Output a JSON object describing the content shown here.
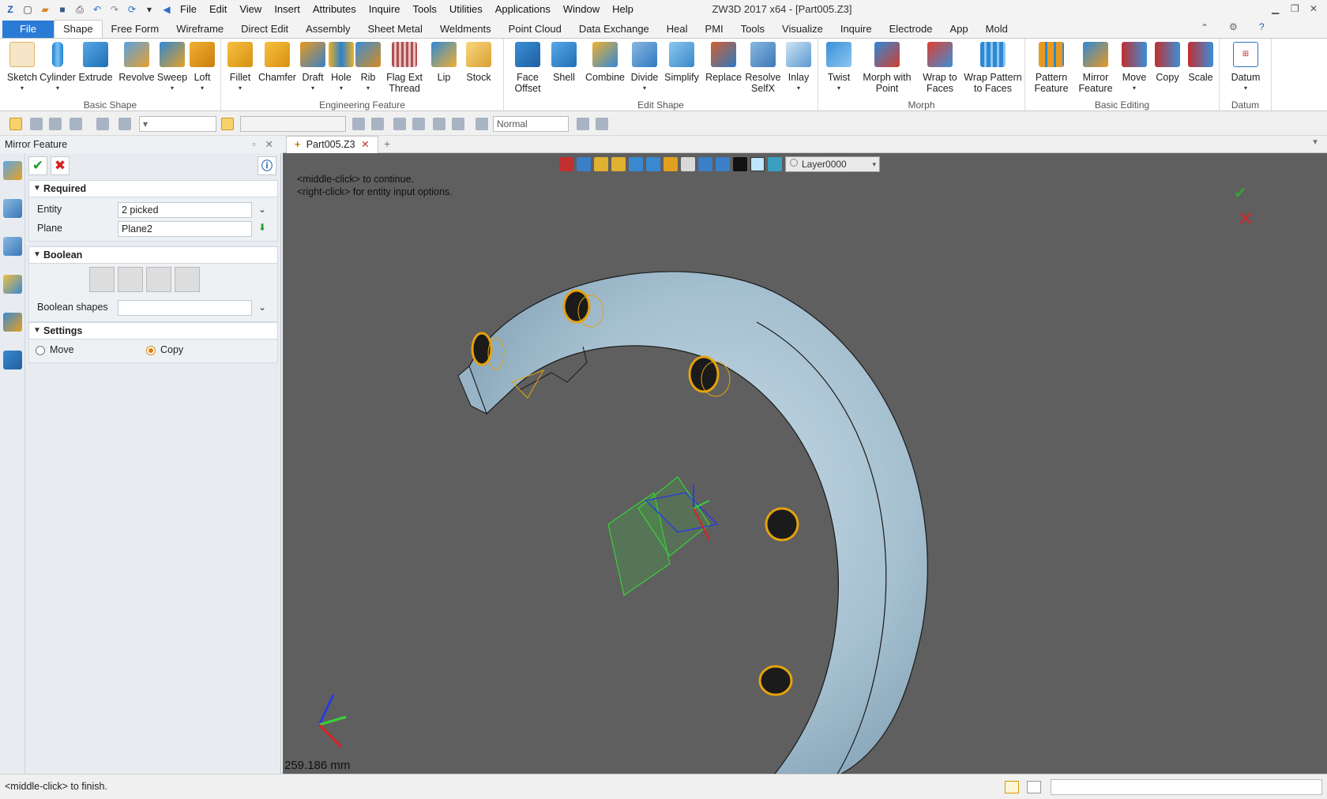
{
  "window": {
    "title": "ZW3D 2017  x64 - [Part005.Z3]"
  },
  "menubar": {
    "items": [
      "File",
      "Edit",
      "View",
      "Insert",
      "Attributes",
      "Inquire",
      "Tools",
      "Utilities",
      "Applications",
      "Window",
      "Help"
    ]
  },
  "ribbon_tabs": [
    "File",
    "Shape",
    "Free Form",
    "Wireframe",
    "Direct Edit",
    "Assembly",
    "Sheet Metal",
    "Weldments",
    "Point Cloud",
    "Data Exchange",
    "Heal",
    "PMI",
    "Tools",
    "Visualize",
    "Inquire",
    "Electrode",
    "App",
    "Mold"
  ],
  "ribbon": {
    "groups": [
      {
        "label": "Basic Shape",
        "buttons": [
          "Sketch",
          "Cylinder",
          "Extrude",
          "Revolve",
          "Sweep",
          "Loft"
        ]
      },
      {
        "label": "Engineering Feature",
        "buttons": [
          "Fillet",
          "Chamfer",
          "Draft",
          "Hole",
          "Rib",
          "Flag Ext Thread",
          "Lip",
          "Stock"
        ]
      },
      {
        "label": "Edit Shape",
        "buttons": [
          "Face Offset",
          "Shell",
          "Combine",
          "Divide",
          "Simplify",
          "Replace",
          "Resolve SelfX",
          "Inlay"
        ]
      },
      {
        "label": "Morph",
        "buttons": [
          "Twist",
          "Morph with Point",
          "Wrap to Faces",
          "Wrap Pattern to Faces"
        ]
      },
      {
        "label": "Basic Editing",
        "buttons": [
          "Pattern Feature",
          "Mirror Feature",
          "Move",
          "Copy",
          "Scale"
        ]
      },
      {
        "label": "Datum",
        "buttons": [
          "Datum"
        ]
      }
    ]
  },
  "toolbar2": {
    "render_mode": "Normal"
  },
  "panel": {
    "title": "Mirror Feature",
    "required": {
      "heading": "Required",
      "entity_label": "Entity",
      "entity_value": "2 picked",
      "plane_label": "Plane",
      "plane_value": "Plane2"
    },
    "boolean": {
      "heading": "Boolean",
      "shapes_label": "Boolean shapes",
      "shapes_value": ""
    },
    "settings": {
      "heading": "Settings",
      "option_move": "Move",
      "option_copy": "Copy",
      "selected": "Copy"
    }
  },
  "document": {
    "tab": "Part005.Z3"
  },
  "viewport": {
    "layer": "Layer0000",
    "hint_1": "<middle-click> to continue.",
    "hint_2": "<right-click> for entity input options.",
    "scale": "259.186 mm"
  },
  "status": {
    "message": "<middle-click> to finish."
  },
  "colors": {
    "file_tab": "#2a7bd5",
    "viewport_bg": "#5f5f5f",
    "part_surface": "#a9c3d3",
    "hole_highlight": "#e6a20c"
  }
}
